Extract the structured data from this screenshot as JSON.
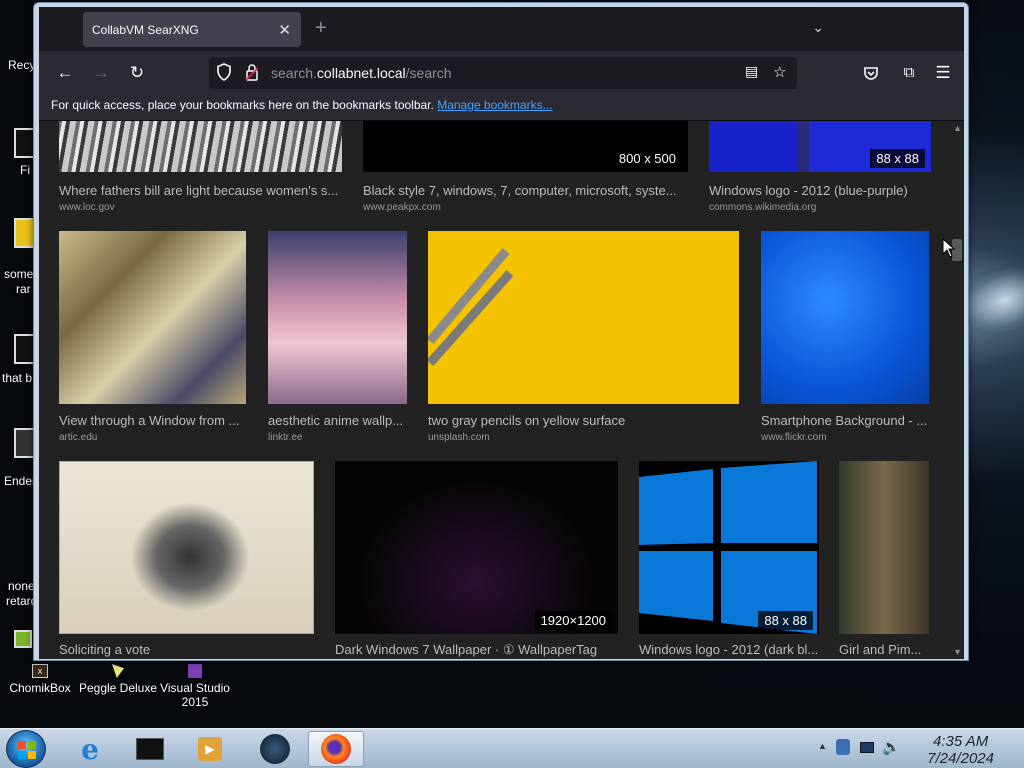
{
  "browser": {
    "tab_title": "CollabVM SearXNG",
    "url_prefix": "search.",
    "url_host": "collabnet.local",
    "url_path": "/search",
    "bookmarks_text": "For quick access, place your bookmarks here on the bookmarks toolbar.",
    "bookmarks_link": "Manage bookmarks..."
  },
  "results": [
    {
      "title": "Where fathers bill are light because women's s...",
      "source": "www.loc.gov",
      "badge": ""
    },
    {
      "title": "Black style 7, windows, 7, computer, microsoft, syste...",
      "source": "www.peakpx.com",
      "badge": "800 x 500"
    },
    {
      "title": "Windows logo - 2012 (blue-purple)",
      "source": "commons.wikimedia.org",
      "badge": "88 x 88"
    },
    {
      "title": "View through a Window from ...",
      "source": "artic.edu",
      "badge": ""
    },
    {
      "title": "aesthetic anime wallp...",
      "source": "linktr.ee",
      "badge": ""
    },
    {
      "title": "two gray pencils on yellow surface",
      "source": "unsplash.com",
      "badge": ""
    },
    {
      "title": "Smartphone Background - ...",
      "source": "www.flickr.com",
      "badge": ""
    },
    {
      "title": "Soliciting a vote",
      "source": "",
      "badge": ""
    },
    {
      "title": "Dark Windows 7 Wallpaper · ① WallpaperTag",
      "source": "",
      "badge": "1920×1200"
    },
    {
      "title": "Windows logo - 2012 (dark bl...",
      "source": "",
      "badge": "88 x 88"
    },
    {
      "title": "Girl and Pim...",
      "source": "",
      "badge": ""
    }
  ],
  "desktop": {
    "icons": [
      {
        "label": "ChomikBox"
      },
      {
        "label": "Peggle Deluxe"
      },
      {
        "label": "Visual Studio 2015"
      }
    ],
    "fragments": [
      "Recy",
      "Fi",
      "some",
      "rar",
      "that b",
      "Ender",
      "none",
      "retard"
    ]
  },
  "taskbar": {
    "time": "4:35 AM",
    "date": "7/24/2024"
  },
  "colors": {
    "accent_link": "#45a1ff",
    "window_frame": "#c7d6e6",
    "ff_dark": "#1c1b22"
  }
}
